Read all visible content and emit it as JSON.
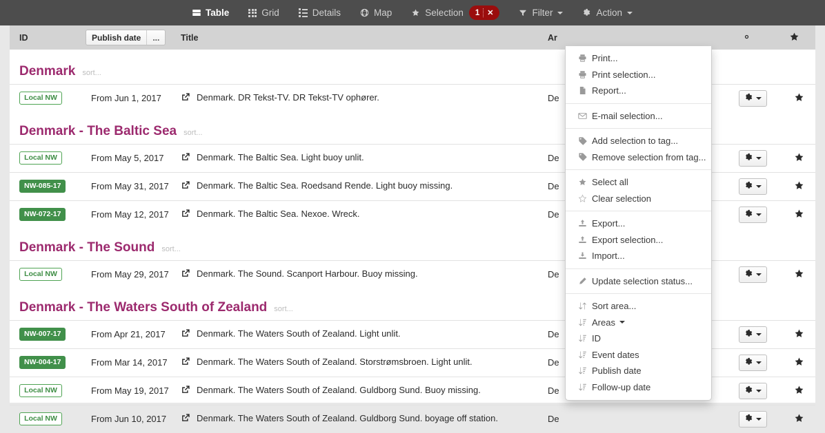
{
  "navbar": {
    "items": [
      {
        "label": "Table",
        "icon": "table-icon",
        "active": true
      },
      {
        "label": "Grid",
        "icon": "grid-icon",
        "active": false
      },
      {
        "label": "Details",
        "icon": "details-icon",
        "active": false
      },
      {
        "label": "Map",
        "icon": "globe-icon",
        "active": false
      },
      {
        "label": "Selection",
        "icon": "star-icon",
        "active": false
      },
      {
        "label": "Filter",
        "icon": "funnel-icon",
        "active": false
      },
      {
        "label": "Action",
        "icon": "gear-icon",
        "active": false
      }
    ],
    "selection_count": "1",
    "selection_clear": "✕"
  },
  "action_menu": {
    "groups": [
      {
        "items": [
          {
            "label": "Print...",
            "icon": "printer-icon"
          },
          {
            "label": "Print selection...",
            "icon": "printer-icon"
          },
          {
            "label": "Report...",
            "icon": "document-icon"
          }
        ]
      },
      {
        "items": [
          {
            "label": "E-mail selection...",
            "icon": "envelope-icon"
          }
        ]
      },
      {
        "items": [
          {
            "label": "Add selection to tag...",
            "icon": "tag-icon"
          },
          {
            "label": "Remove selection from tag...",
            "icon": "tag-icon"
          }
        ]
      },
      {
        "items": [
          {
            "label": "Select all",
            "icon": "star-filled-icon"
          },
          {
            "label": "Clear selection",
            "icon": "star-outline-icon"
          }
        ]
      },
      {
        "items": [
          {
            "label": "Export...",
            "icon": "export-icon"
          },
          {
            "label": "Export selection...",
            "icon": "export-icon"
          },
          {
            "label": "Import...",
            "icon": "import-icon"
          }
        ]
      },
      {
        "items": [
          {
            "label": "Update selection status...",
            "icon": "pencil-icon"
          }
        ]
      },
      {
        "items": [
          {
            "label": "Sort area...",
            "icon": "sort-icon"
          },
          {
            "label": "Areas",
            "icon": "sort-az-icon",
            "caret": true
          },
          {
            "label": "ID",
            "icon": "sort-az-icon"
          },
          {
            "label": "Event dates",
            "icon": "sort-az-icon"
          },
          {
            "label": "Publish date",
            "icon": "sort-az-icon"
          },
          {
            "label": "Follow-up date",
            "icon": "sort-az-icon"
          }
        ]
      }
    ]
  },
  "table": {
    "columns": {
      "id": "ID",
      "publish_date": "Publish date",
      "publish_date_more": "...",
      "title": "Title",
      "areas": "Ar",
      "gear": "gear-icon",
      "star": "star-icon"
    },
    "group_sort_label": "sort...",
    "groups": [
      {
        "name": "Denmark",
        "rows": [
          {
            "badge": "Local NW",
            "badge_type": "local",
            "date": "From Jun 1, 2017",
            "title": "Denmark. DR Tekst-TV. DR Tekst-TV ophører.",
            "area": "De"
          }
        ]
      },
      {
        "name": "Denmark - The Baltic Sea",
        "rows": [
          {
            "badge": "Local NW",
            "badge_type": "local",
            "date": "From May 5, 2017",
            "title": "Denmark. The Baltic Sea. Light buoy unlit.",
            "area": "De"
          },
          {
            "badge": "NW-085-17",
            "badge_type": "nw",
            "date": "From May 31, 2017",
            "title": "Denmark. The Baltic Sea. Roedsand Rende. Light buoy missing.",
            "area": "De"
          },
          {
            "badge": "NW-072-17",
            "badge_type": "nw",
            "date": "From May 12, 2017",
            "title": "Denmark. The Baltic Sea. Nexoe. Wreck.",
            "area": "De"
          }
        ]
      },
      {
        "name": "Denmark - The Sound",
        "rows": [
          {
            "badge": "Local NW",
            "badge_type": "local",
            "date": "From May 29, 2017",
            "title": "Denmark. The Sound. Scanport Harbour. Buoy missing.",
            "area": "De"
          }
        ]
      },
      {
        "name": "Denmark - The Waters South of Zealand",
        "rows": [
          {
            "badge": "NW-007-17",
            "badge_type": "nw",
            "date": "From Apr 21, 2017",
            "title": "Denmark. The Waters South of Zealand. Light unlit.",
            "area": "De"
          },
          {
            "badge": "NW-004-17",
            "badge_type": "nw",
            "date": "From Mar 14, 2017",
            "title": "Denmark. The Waters South of Zealand. Storstrømsbroen. Light unlit.",
            "area": "De"
          },
          {
            "badge": "Local NW",
            "badge_type": "local",
            "date": "From May 19, 2017",
            "title": "Denmark. The Waters South of Zealand. Guldborg Sund. Buoy missing.",
            "area": "De"
          },
          {
            "badge": "Local NW",
            "badge_type": "local",
            "date": "From Jun 10, 2017",
            "title": "Denmark. The Waters South of Zealand. Guldborg Sund. boyage off station.",
            "area": "De"
          }
        ]
      }
    ]
  },
  "colors": {
    "navbar_bg": "#4d4d4d",
    "group_title": "#9c2a6e",
    "badge_green": "#41904a",
    "selection_red": "#9b0d0d",
    "header_bg": "#d3d3d3"
  }
}
